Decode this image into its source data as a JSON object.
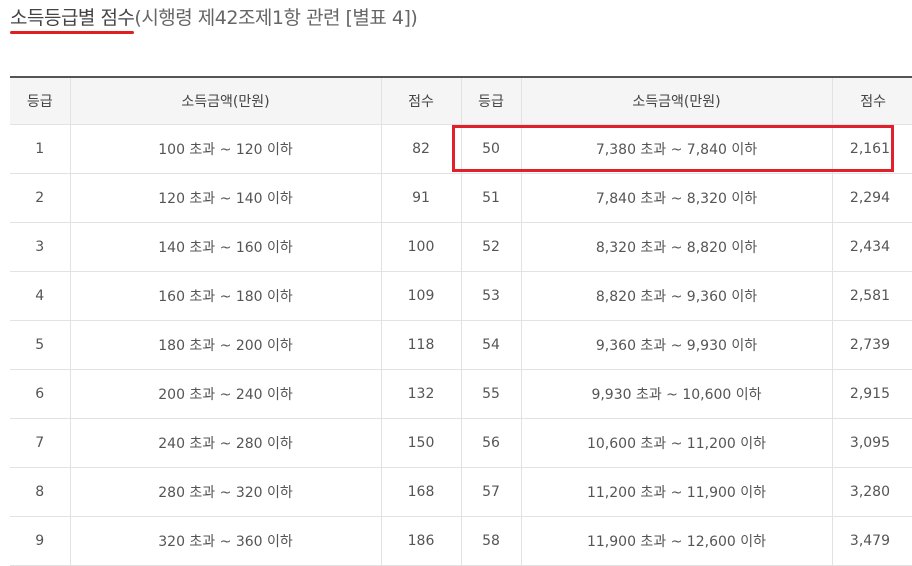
{
  "title": {
    "main": "소득등급별 점수",
    "sub": "(시행령 제42조제1항 관련 [별표 4])"
  },
  "colors": {
    "accent_red": "#e0201f",
    "header_bg": "#f5f5f5"
  },
  "table": {
    "headers": [
      "등급",
      "소득금액(만원)",
      "점수",
      "등급",
      "소득금액(만원)",
      "점수"
    ],
    "rows": [
      [
        "1",
        "100 초과 ~ 120 이하",
        "82",
        "50",
        "7,380 초과 ~ 7,840 이하",
        "2,161"
      ],
      [
        "2",
        "120 초과 ~ 140 이하",
        "91",
        "51",
        "7,840 초과 ~ 8,320 이하",
        "2,294"
      ],
      [
        "3",
        "140 초과 ~ 160 이하",
        "100",
        "52",
        "8,320 초과 ~ 8,820 이하",
        "2,434"
      ],
      [
        "4",
        "160 초과 ~ 180 이하",
        "109",
        "53",
        "8,820 초과 ~ 9,360 이하",
        "2,581"
      ],
      [
        "5",
        "180 초과 ~ 200 이하",
        "118",
        "54",
        "9,360 초과 ~ 9,930 이하",
        "2,739"
      ],
      [
        "6",
        "200 초과 ~ 240 이하",
        "132",
        "55",
        "9,930 초과 ~ 10,600 이하",
        "2,915"
      ],
      [
        "7",
        "240 초과 ~ 280 이하",
        "150",
        "56",
        "10,600 초과 ~ 11,200 이하",
        "3,095"
      ],
      [
        "8",
        "280 초과 ~ 320 이하",
        "168",
        "57",
        "11,200 초과 ~ 11,900 이하",
        "3,280"
      ],
      [
        "9",
        "320 초과 ~ 360 이하",
        "186",
        "58",
        "11,900 초과 ~ 12,600 이하",
        "3,479"
      ]
    ]
  }
}
